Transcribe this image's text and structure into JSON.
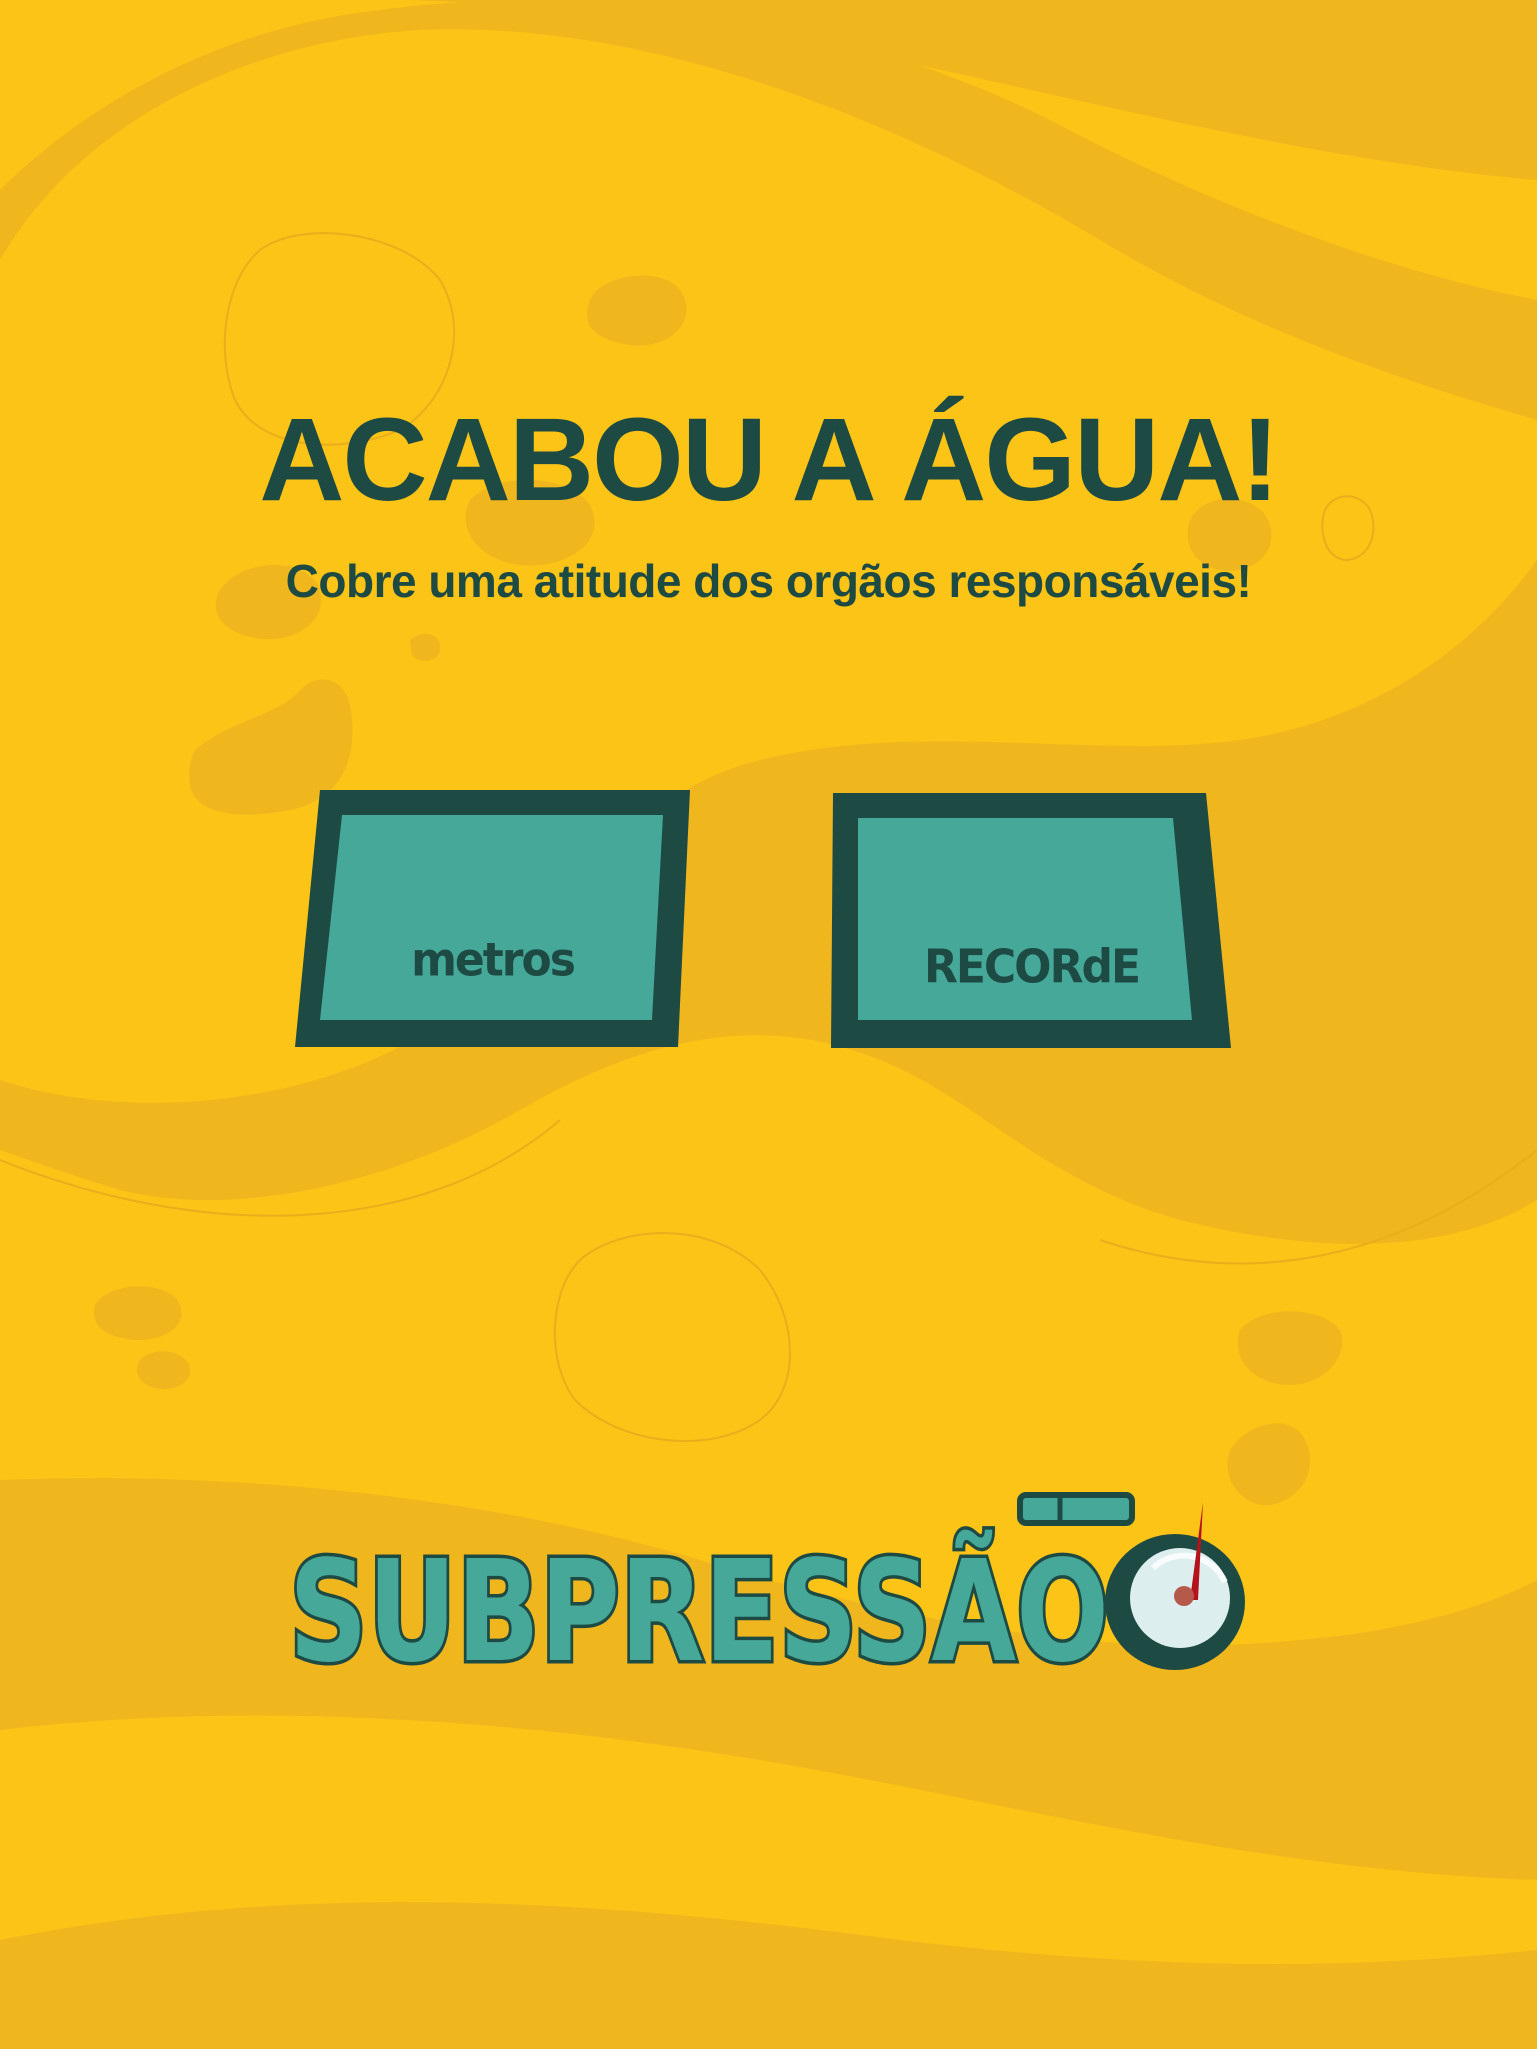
{
  "screen": {
    "title": "ACABOU A ÁGUA!",
    "subtitle": "Cobre uma atitude dos orgãos responsáveis!"
  },
  "panels": {
    "metros": {
      "label": "metros"
    },
    "recorde": {
      "label": "RECORdE"
    }
  },
  "logo": {
    "text": "SUBPRESSÃO"
  },
  "colors": {
    "background": "#FBC416",
    "background_shade": "#F0B61E",
    "dark_teal": "#1E4A44",
    "teal": "#45A898",
    "gauge_needle": "#B5121B"
  }
}
